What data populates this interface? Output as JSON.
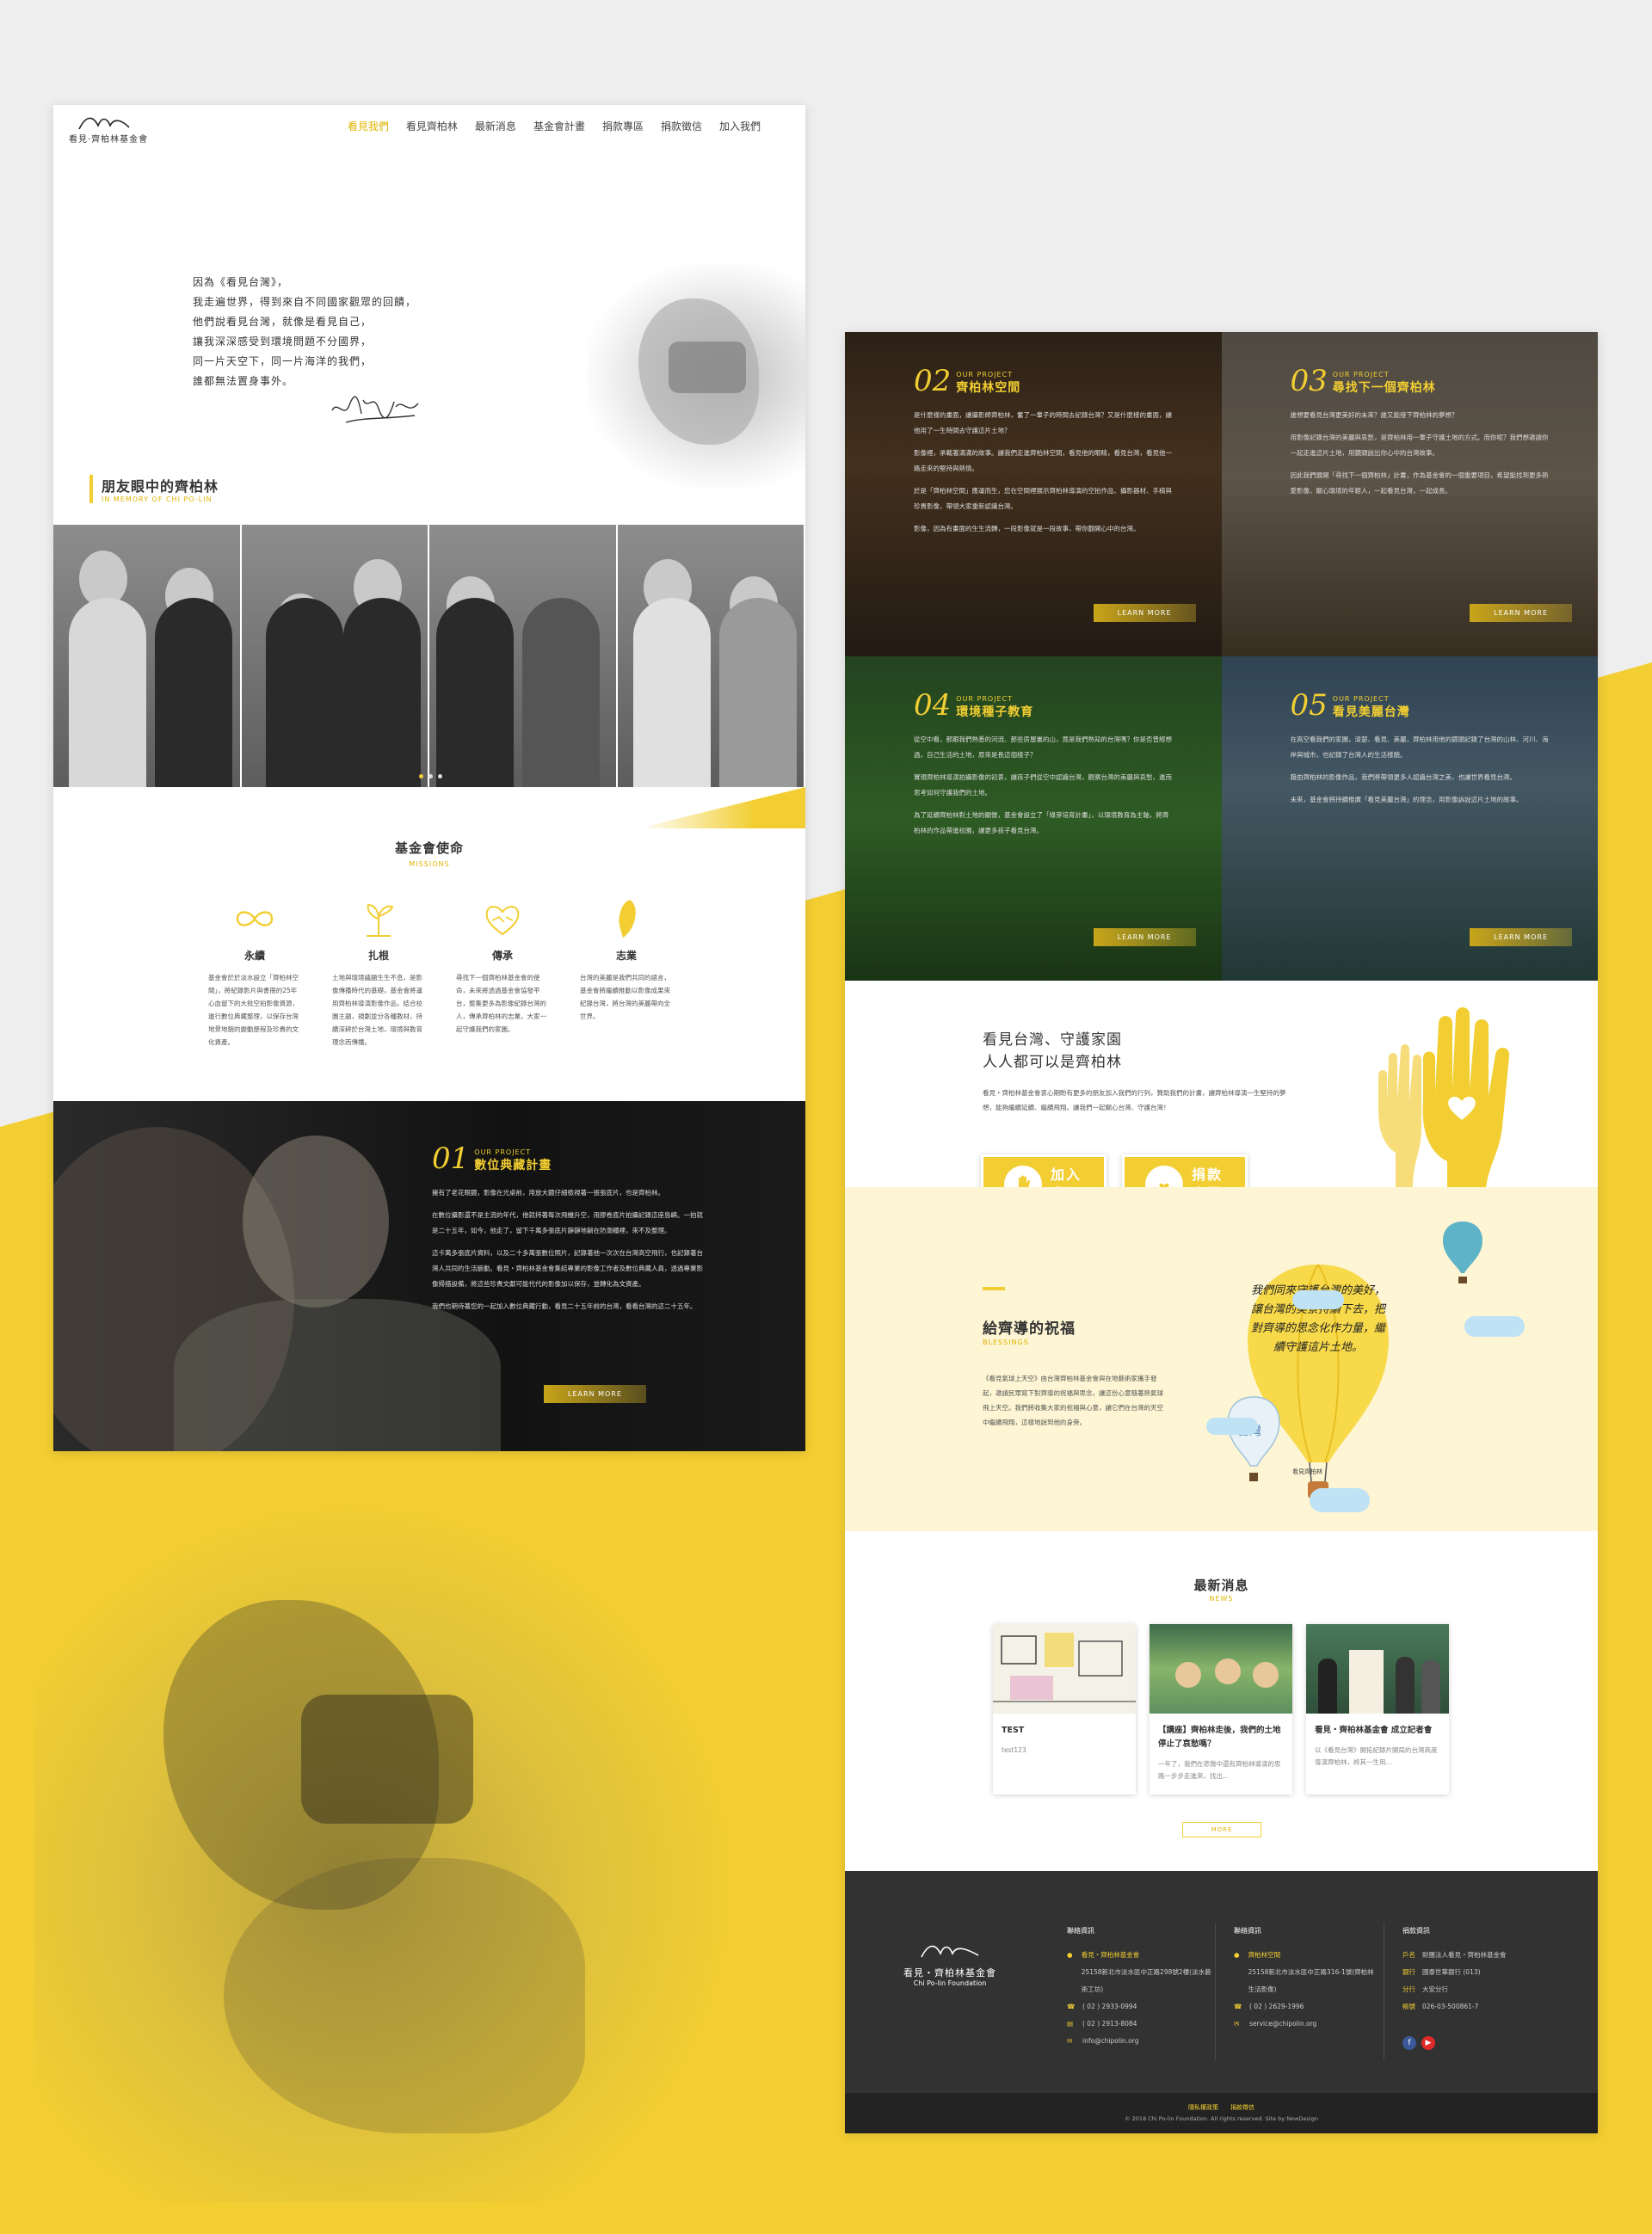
{
  "site": {
    "logo_text": "看見·齊柏林基金會",
    "nav": [
      "看見我們",
      "看見齊柏林",
      "最新消息",
      "基金會計畫",
      "捐款專區",
      "捐款徵信",
      "加入我們"
    ]
  },
  "hero": {
    "quote_lines": [
      "因為《看見台灣》，",
      "我走遍世界，得到來自不同國家觀眾的回饋，",
      "他們說看見台灣，就像是看見自己，",
      "讓我深深感受到環境問題不分國界，",
      "同一片天空下，同一片海洋的我們，",
      "誰都無法置身事外。"
    ]
  },
  "memory": {
    "title": "朋友眼中的齊柏林",
    "subtitle": "IN MEMORY OF CHI PO-LIN"
  },
  "missions": {
    "title": "基金會使命",
    "subtitle": "MISSIONS",
    "items": [
      {
        "name": "永續",
        "icon": "infinity-icon",
        "desc": "基金會於於淡水設立「齊柏林空間」，將紀錄影片與書冊的25年心血留下的大批空拍影像資源，進行數位典藏整理，以保存台灣地景地貌的變動歷程及珍貴的文化資產。"
      },
      {
        "name": "扎根",
        "icon": "sprout-icon",
        "desc": "土地與環境議題生生不息，是影像傳播時代的基礎，基金會將運用齊柏林導演影像作品，結合校園主題，規劃並分各種教材，持續深耕於台灣土地，環境與教育理念而傳播。"
      },
      {
        "name": "傳承",
        "icon": "heart-hands-icon",
        "desc": "尋找下一個齊柏林基金會的使命，未來將透過基金會協發平台，整集更多為影像紀錄台灣的人，傳承齊柏林的志業，大家一起守護我們的家園。"
      },
      {
        "name": "志業",
        "icon": "taiwan-icon",
        "desc": "台灣的美麗是我們共同的語言，基金會將繼續推動以影像成果來紀錄台灣，將台灣的美麗帶向全世界。"
      }
    ]
  },
  "project01": {
    "num": "01",
    "small": "OUR PROJECT",
    "name": "數位典藏計畫",
    "body": [
      "擁有了老花眼鏡，影像在光桌前，用放大鏡仔細檢視著一張張底片，也是齊柏林。",
      "在數位攝影還不是主流的年代，他就持著每次飛機升空，用膠卷底片拍攝記錄這座島嶼。一拍就是二十五年，如今，他走了，留下千萬多張底片靜靜地躺在防潮櫃裡，來不及整理。",
      "這卡萬多張底片資料，以及二十多萬張數位照片，記錄著他一次次在台灣高空飛行，也記錄著台灣人共同的生活脈動。看見・齊柏林基金會集結專業的影像工作者及數位典藏人員，透過專業影像掃描設備，將這些珍貴文獻可能代代的影像加以保存，並轉化為文資產。",
      "我們也期待著您的一起加入數位典藏行動，看見二十五年前的台灣，看看台灣的這二十五年。"
    ],
    "btn": "LEARN MORE"
  },
  "projects": [
    {
      "num": "02",
      "small": "OUR PROJECT",
      "name": "齊柏林空間",
      "btn": "LEARN MORE",
      "body": [
        "是什麼樣的畫面，讓攝影師齊柏林，奮了一輩子的時間去記錄台灣？又是什麼樣的畫面，讓他用了一生時間去守護這片土地？",
        "影像裡，承載著滿滿的故事。讓我們走進齊柏林空間，看見他的眼睛，看見台灣，看見他一路走來的堅持與熱情。",
        "於是「齊柏林空間」應運而生，您在空間裡展示齊柏林導演的空拍作品、攝影器材、手稿與珍貴影像，帶領大家重新認識台灣。",
        "影像，因為有畫面的生生流轉，一段影像就是一段故事，帶你翻開心中的台灣。"
      ]
    },
    {
      "num": "03",
      "small": "OUR PROJECT",
      "name": "尋找下一個齊柏林",
      "btn": "LEARN MORE",
      "body": [
        "誰想要看見台灣更美好的未來？誰又能接下齊柏林的夢想？",
        "用影像記錄台灣的美麗與哀愁，是齊柏林用一輩子守護土地的方式。而你呢？我們想邀請你一起走進這片土地，用鏡頭說出你心中的台灣故事。",
        "因此我們展開「尋找下一個齊柏林」計畫，作為基金會的一個重要項目，希望能找到更多熱愛影像、關心環境的年輕人，一起看見台灣，一起成長。"
      ]
    },
    {
      "num": "04",
      "small": "OUR PROJECT",
      "name": "環境種子教育",
      "btn": "LEARN MORE",
      "body": [
        "從空中看，那跟我們熟悉的河流、那些房屋裏的山，竟是我們熟知的台灣嗎？你是否曾經想過，自己生活的土地，原來是長這個樣子？",
        "實現齊柏林導演拍攝影像的初衷，讓孩子們從空中認識台灣，觀察台灣的美麗與哀愁，進而思考如何守護我們的土地。",
        "為了延續齊柏林對土地的關懷，基金會設立了「綠芽培育計畫」，以環境教育為主軸，將齊柏林的作品帶進校園，讓更多孩子看見台灣。"
      ]
    },
    {
      "num": "05",
      "small": "OUR PROJECT",
      "name": "看見美麗台灣",
      "btn": "LEARN MORE",
      "body": [
        "在高空看我們的家園，清楚、看見、美麗，齊柏林用他的鏡頭記錄了台灣的山林、河川、海岸與城市，也記錄了台灣人的生活樣貌。",
        "藉由齊柏林的影像作品，我們將帶領更多人認識台灣之美，也讓世界看見台灣。",
        "未來，基金會將持續推廣「看見美麗台灣」的理念，用影像訴說這片土地的故事。"
      ]
    }
  ],
  "support": {
    "heading_lines": [
      "看見台灣、守護家園",
      "人人都可以是齊柏林"
    ],
    "body": "看見・齊柏林基金會衷心期盼有更多的朋友加入我們的行列，贊助我們的計畫，讓齊柏林導演一生堅持的夢想，能夠繼續延續、繼續飛翔。讓我們一起關心台灣、守護台灣！",
    "btn_join_lines": [
      "加入",
      "我們"
    ],
    "btn_donate_lines": [
      "捐款",
      "專區"
    ]
  },
  "blessing": {
    "title": "給齊導的祝福",
    "subtitle": "BLESSINGS",
    "body": "《看見氣球上天空》由台灣齊柏林基金會與在地藝術家攜手發起，邀請民眾寫下對齊導的祝福與思念，讓這份心意隨著熱氣球飛上天空。我們將收集大家的祝福與心意，讓它們在台灣的天空中繼續飛翔，這樣地說到他的身旁。",
    "balloon_text": "我們同來守護台灣的美好，讓台灣的美景持續下去，把對齊導的思念化作力量，繼續守護這片土地。",
    "balloon_caption": "看見齊柏林"
  },
  "news": {
    "title": "最新消息",
    "subtitle": "NEWS",
    "items": [
      {
        "title": "TEST",
        "desc": "test123"
      },
      {
        "title": "【講座】齊柏林走後，我們的土地停止了哀愁嗎？",
        "desc": "一年了，我們在悲傷中還有齊柏林導演的思路一步步走進來，找出..."
      },
      {
        "title": "看見・齊柏林基金會 成立記者會",
        "desc": "以《看見台灣》開拓紀錄片開局的台灣高度導演齊柏林，終其一生用..."
      }
    ],
    "more": "MORE"
  },
  "footer": {
    "logo_cn": "看見・齊柏林基金會",
    "logo_en": "Chi Po-lin Foundation",
    "col1": {
      "title": "聯絡資訊",
      "org": "看見・齊柏林基金會",
      "address": "25158新北市淡水區中正路298號2樓(淡水藝術工坊)",
      "tel": "( 02 ) 2933-0994",
      "fax": "( 02 ) 2913-8084",
      "email": "info@chipolin.org"
    },
    "col2": {
      "title": "聯絡資訊",
      "org": "齊柏林空間",
      "address": "25158新北市淡水區中正路316-1號(齊柏林生活影像)",
      "tel": "( 02 ) 2629-1996",
      "email": "service@chipolin.org"
    },
    "col3": {
      "title": "捐款資訊",
      "rows": [
        {
          "k": "戶名",
          "v": "財團法人看見・齊柏林基金會"
        },
        {
          "k": "銀行",
          "v": "國泰世華銀行 (013)"
        },
        {
          "k": "分行",
          "v": "大安分行"
        },
        {
          "k": "帳號",
          "v": "026-03-500861-7"
        }
      ]
    },
    "links": "隱私權政策　　捐款徵信",
    "copyright": "© 2018 Chi Po-lin Foundation. All rights reserved. Site by NewDesign"
  },
  "colors": {
    "accent": "#f2ce32",
    "dark": "#323232",
    "cream": "#fdf5d3"
  }
}
